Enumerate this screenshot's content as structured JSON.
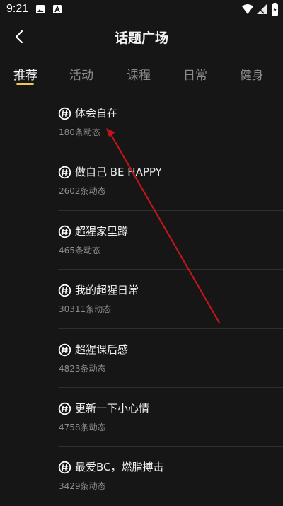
{
  "status": {
    "time": "9:21"
  },
  "header": {
    "title": "话题广场"
  },
  "tabs": [
    {
      "label": "推荐",
      "active": true
    },
    {
      "label": "活动",
      "active": false
    },
    {
      "label": "课程",
      "active": false
    },
    {
      "label": "日常",
      "active": false
    },
    {
      "label": "健身",
      "active": false
    }
  ],
  "topics": [
    {
      "name": "体会自在",
      "count": "180条动态"
    },
    {
      "name": "做自己 BE HAPPY",
      "count": "2602条动态"
    },
    {
      "name": "超猩家里蹲",
      "count": "465条动态"
    },
    {
      "name": "我的超猩日常",
      "count": "30311条动态"
    },
    {
      "name": "超猩课后感",
      "count": "4823条动态"
    },
    {
      "name": "更新一下小心情",
      "count": "4758条动态"
    },
    {
      "name": "最爱BC，燃脂搏击",
      "count": "3429条动态"
    }
  ],
  "colors": {
    "background": "#161616",
    "accent": "#f2c94c",
    "annotation": "#c0161b"
  }
}
